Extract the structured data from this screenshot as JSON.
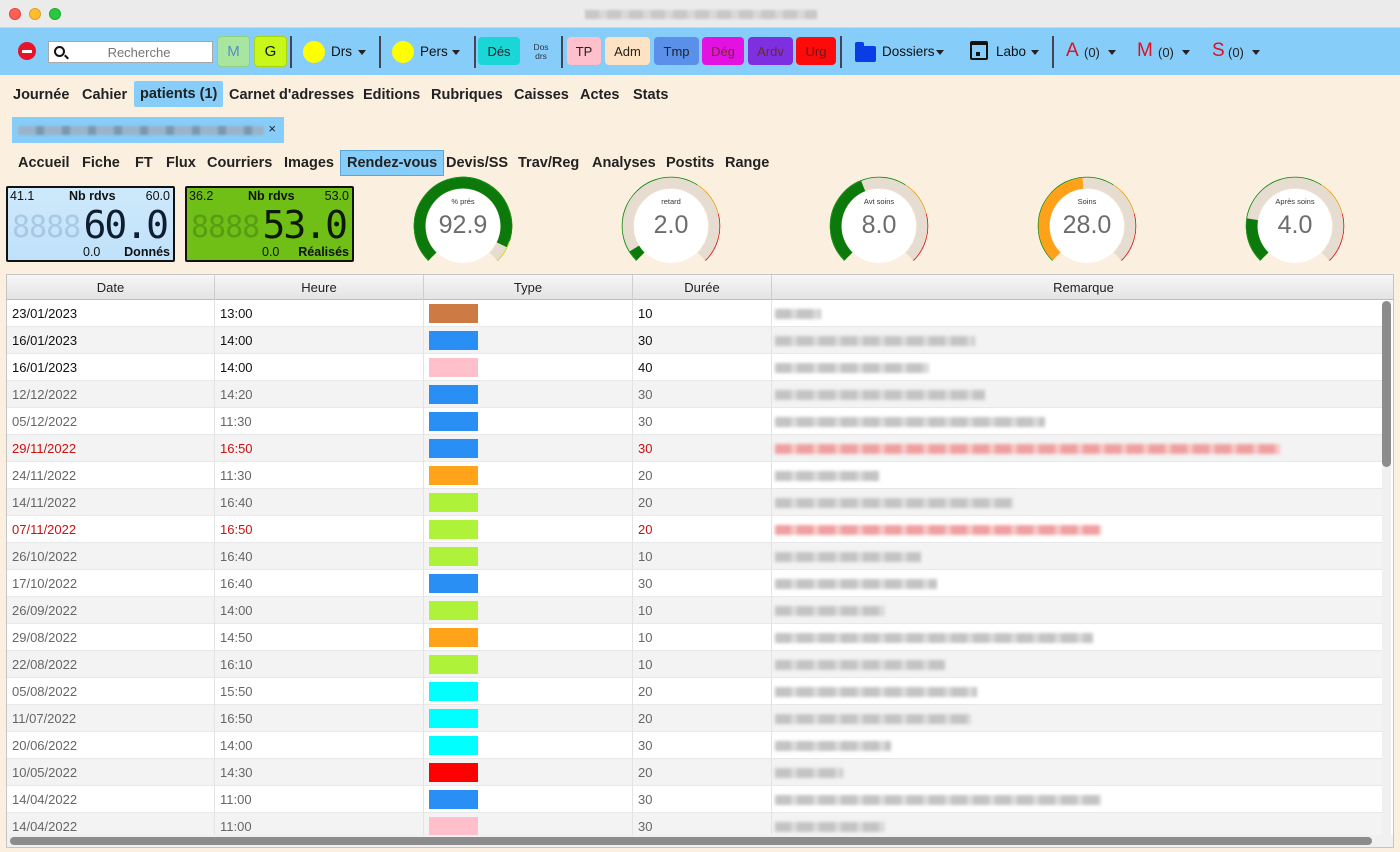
{
  "toolbar": {
    "search_placeholder": "Recherche",
    "m_label": "M",
    "g_label": "G",
    "drs_label": "Drs",
    "pers_label": "Pers",
    "des_label": "Dés",
    "dos_label": "Dos drs",
    "tp_label": "TP",
    "adm_label": "Adm",
    "tmp_label": "Tmp",
    "deg_label": "Dég",
    "ardv_label": "Ardv",
    "urg_label": "Urg",
    "dossiers_label": "Dossiers",
    "labo_label": "Labo",
    "a_letter": "A",
    "a_count": "(0)",
    "m_letter": "M",
    "m_count": "(0)",
    "s_letter": "S",
    "s_count": "(0)"
  },
  "main_tabs": [
    "Journée",
    "Cahier",
    "patients (1)",
    "Carnet d'adresses",
    "Editions",
    "Rubriques",
    "Caisses",
    "Actes",
    "Stats"
  ],
  "patient_chip": {
    "close": "×"
  },
  "sub_tabs": [
    "Accueil",
    "Fiche",
    "FT",
    "Flux",
    "Courriers",
    "Images",
    "Rendez-vous",
    "Devis/SS",
    "Trav/Reg",
    "Analyses",
    "Postits",
    "Range"
  ],
  "counters": [
    {
      "min": "41.1",
      "title": "Nb rdvs",
      "max": "60.0",
      "value": "60.0",
      "low": "0.0",
      "caption": "Donnés",
      "ghost": "8888"
    },
    {
      "min": "36.2",
      "title": "Nb rdvs",
      "max": "53.0",
      "value": "53.0",
      "low": "0.0",
      "caption": "Réalisés",
      "ghost": "8888"
    }
  ],
  "gauges": [
    {
      "label": "% prés",
      "value": "92.9",
      "fraction": 0.929,
      "color": "#0b7a0b"
    },
    {
      "label": "retard",
      "value": "2.0",
      "fraction": 0.05,
      "color": "#0b7a0b"
    },
    {
      "label": "Avt soins",
      "value": "8.0",
      "fraction": 0.42,
      "color": "#0b7a0b"
    },
    {
      "label": "Soins",
      "value": "28.0",
      "fraction": 0.48,
      "color": "#ffa21a"
    },
    {
      "label": "Après soins",
      "value": "4.0",
      "fraction": 0.2,
      "color": "#0b7a0b"
    }
  ],
  "table": {
    "columns": [
      "Date",
      "Heure",
      "Type",
      "Durée",
      "Remarque"
    ],
    "rows": [
      {
        "date": "23/01/2023",
        "heure": "13:00",
        "type_color": "#cd7a45",
        "duree": "10",
        "state": "future"
      },
      {
        "date": "16/01/2023",
        "heure": "14:00",
        "type_color": "#2a8ff5",
        "duree": "30",
        "state": "future"
      },
      {
        "date": "16/01/2023",
        "heure": "14:00",
        "type_color": "#ffc0cb",
        "duree": "40",
        "state": "future"
      },
      {
        "date": "12/12/2022",
        "heure": "14:20",
        "type_color": "#2a8ff5",
        "duree": "30",
        "state": "past"
      },
      {
        "date": "05/12/2022",
        "heure": "11:30",
        "type_color": "#2a8ff5",
        "duree": "30",
        "state": "past"
      },
      {
        "date": "29/11/2022",
        "heure": "16:50",
        "type_color": "#2a8ff5",
        "duree": "30",
        "state": "missed"
      },
      {
        "date": "24/11/2022",
        "heure": "11:30",
        "type_color": "#ffa31a",
        "duree": "20",
        "state": "past"
      },
      {
        "date": "14/11/2022",
        "heure": "16:40",
        "type_color": "#aef23a",
        "duree": "20",
        "state": "past"
      },
      {
        "date": "07/11/2022",
        "heure": "16:50",
        "type_color": "#aef23a",
        "duree": "20",
        "state": "missed"
      },
      {
        "date": "26/10/2022",
        "heure": "16:40",
        "type_color": "#aef23a",
        "duree": "10",
        "state": "past"
      },
      {
        "date": "17/10/2022",
        "heure": "16:40",
        "type_color": "#2a8ff5",
        "duree": "30",
        "state": "past"
      },
      {
        "date": "26/09/2022",
        "heure": "14:00",
        "type_color": "#aef23a",
        "duree": "10",
        "state": "past"
      },
      {
        "date": "29/08/2022",
        "heure": "14:50",
        "type_color": "#ffa31a",
        "duree": "10",
        "state": "past"
      },
      {
        "date": "22/08/2022",
        "heure": "16:10",
        "type_color": "#aef23a",
        "duree": "10",
        "state": "past"
      },
      {
        "date": "05/08/2022",
        "heure": "15:50",
        "type_color": "#00ffff",
        "duree": "20",
        "state": "past"
      },
      {
        "date": "11/07/2022",
        "heure": "16:50",
        "type_color": "#00ffff",
        "duree": "20",
        "state": "past"
      },
      {
        "date": "20/06/2022",
        "heure": "14:00",
        "type_color": "#00ffff",
        "duree": "30",
        "state": "past"
      },
      {
        "date": "10/05/2022",
        "heure": "14:30",
        "type_color": "#ff0000",
        "duree": "20",
        "state": "past"
      },
      {
        "date": "14/04/2022",
        "heure": "11:00",
        "type_color": "#2a8ff5",
        "duree": "30",
        "state": "past"
      },
      {
        "date": "14/04/2022",
        "heure": "11:00",
        "type_color": "#ffc0cb",
        "duree": "30",
        "state": "past"
      }
    ]
  },
  "colors": {
    "toolbar_bg": "#87cdf9",
    "page_bg": "#fbf0e0",
    "missed_text": "#cc1010",
    "past_text": "#666666",
    "future_text": "#111111"
  }
}
